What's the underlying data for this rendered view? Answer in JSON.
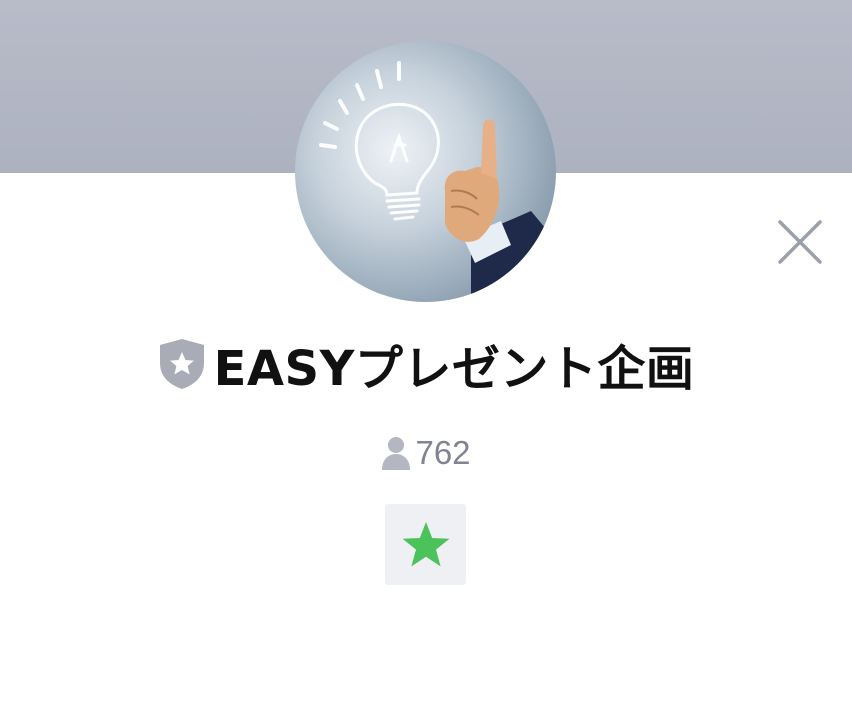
{
  "profile": {
    "name": "EASYプレゼント企画",
    "friend_count": "762"
  },
  "icons": {
    "avatar": "lightbulb-pointing-hand-image",
    "badge": "certified-shield-star-icon",
    "close": "close-icon",
    "friends": "person-icon",
    "favorite": "star-icon"
  },
  "colors": {
    "cover": "#b3b8c5",
    "favorite_star": "#4cc35a",
    "badge": "#a9acb6",
    "muted_text": "#808391"
  }
}
